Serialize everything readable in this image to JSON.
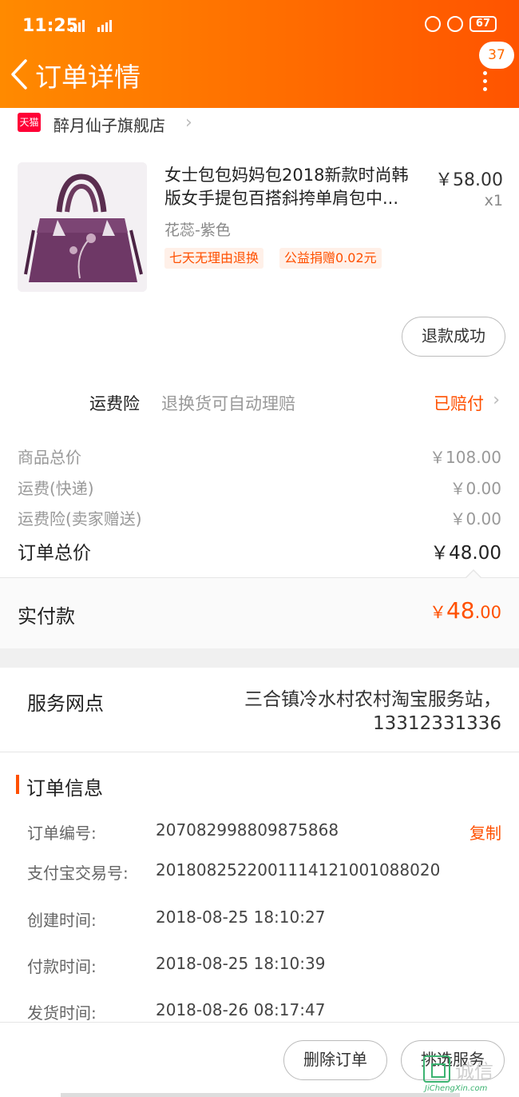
{
  "status_bar": {
    "time": "11:25",
    "network": "2G⁴⁶ 4G⁺",
    "battery": "67"
  },
  "header": {
    "title": "订单详情",
    "badge_count": "37"
  },
  "shop": {
    "platform_badge": "天猫",
    "name": "醉月仙子旗舰店"
  },
  "product": {
    "title_line1": "女士包包妈妈包2018新款时尚韩",
    "title_line2": "版女手提包百搭斜挎单肩包中...",
    "price": "￥58.00",
    "quantity": "x1",
    "sku": "花蕊-紫色",
    "tags": [
      "七天无理由退换",
      "公益捐赠0.02元"
    ],
    "refund_button": "退款成功"
  },
  "freight_insurance": {
    "label": "运费险",
    "description": "退换货可自动理赔",
    "status": "已赔付"
  },
  "summary": {
    "rows": [
      {
        "label": "商品总价",
        "value": "￥108.00"
      },
      {
        "label": "运费(快递)",
        "value": "￥0.00"
      },
      {
        "label": "运费险(卖家赠送)",
        "value": "￥0.00"
      }
    ],
    "total_label": "订单总价",
    "total_value": "￥48.00"
  },
  "paid": {
    "label": "实付款",
    "symbol": "￥",
    "integer": "48",
    "decimal": ".00"
  },
  "service_point": {
    "label": "服务网点",
    "line1": "三合镇冷水村农村淘宝服务站，",
    "line2": "13312331336"
  },
  "order_info": {
    "heading": "订单信息",
    "copy_label": "复制",
    "rows": [
      {
        "key": "订单编号:",
        "value": "207082998809875868"
      },
      {
        "key": "支付宝交易号:",
        "value": "2018082522001114121001088020"
      },
      {
        "key": "创建时间:",
        "value": "2018-08-25 18:10:27"
      },
      {
        "key": "付款时间:",
        "value": "2018-08-25 18:10:39"
      },
      {
        "key": "发货时间:",
        "value": "2018-08-26 08:17:47"
      }
    ]
  },
  "footer": {
    "delete_button": "删除订单",
    "service_button": "挑选服务"
  },
  "watermark": {
    "text": "诚信",
    "url": "JiChengXin.com"
  },
  "colors": {
    "accent": "#ff5000",
    "header_start": "#ff8a00",
    "header_end": "#ff5400",
    "tmall": "#ff0036"
  },
  "icons": {
    "back": "chevron-left-icon",
    "more": "more-vertical-icon",
    "shop_arrow": "chevron-right-icon"
  }
}
